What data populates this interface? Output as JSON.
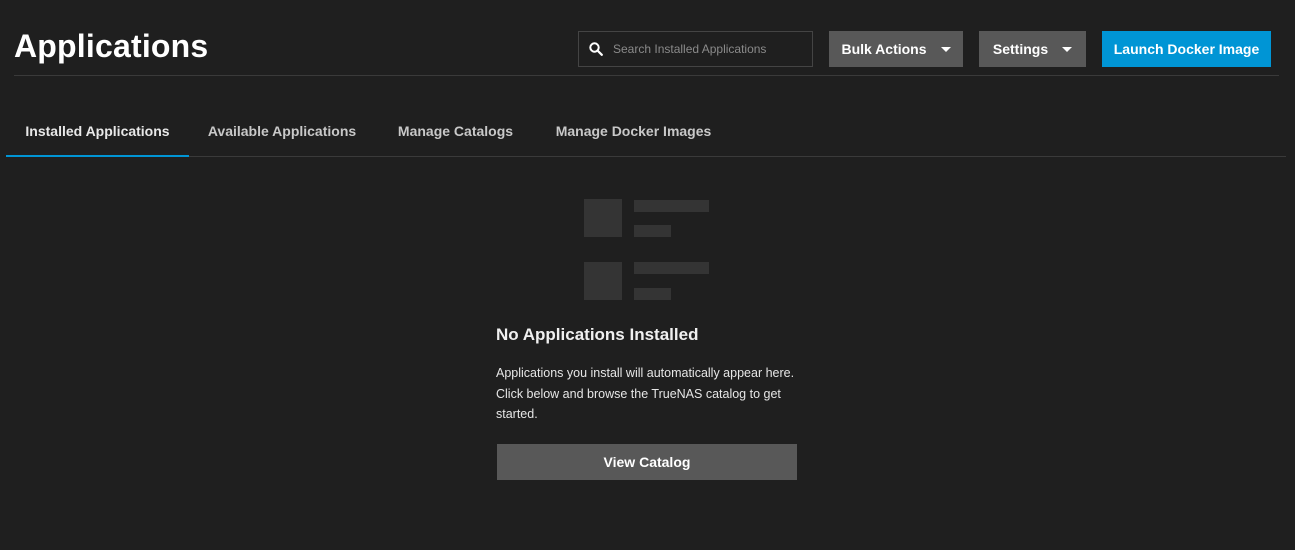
{
  "header": {
    "title": "Applications",
    "search": {
      "placeholder": "Search Installed Applications",
      "value": ""
    },
    "buttons": {
      "bulk_actions": "Bulk Actions",
      "settings": "Settings",
      "launch_docker_image": "Launch Docker Image"
    }
  },
  "tabs": [
    {
      "label": "Installed Applications",
      "active": true
    },
    {
      "label": "Available Applications",
      "active": false
    },
    {
      "label": "Manage Catalogs",
      "active": false
    },
    {
      "label": "Manage Docker Images",
      "active": false
    }
  ],
  "empty_state": {
    "title": "No Applications Installed",
    "message": "Applications you install will automatically appear here. Click below and browse the TrueNAS catalog to get started.",
    "button": "View Catalog"
  },
  "icons": {
    "search": "search-icon",
    "dropdown": "caret-down-icon",
    "empty": "list-placeholder-icon"
  },
  "colors": {
    "background": "#1f1f1f",
    "accent": "#0095d5",
    "button_gray": "#585858",
    "divider": "#3a3a3a",
    "placeholder_shape": "#343434"
  }
}
